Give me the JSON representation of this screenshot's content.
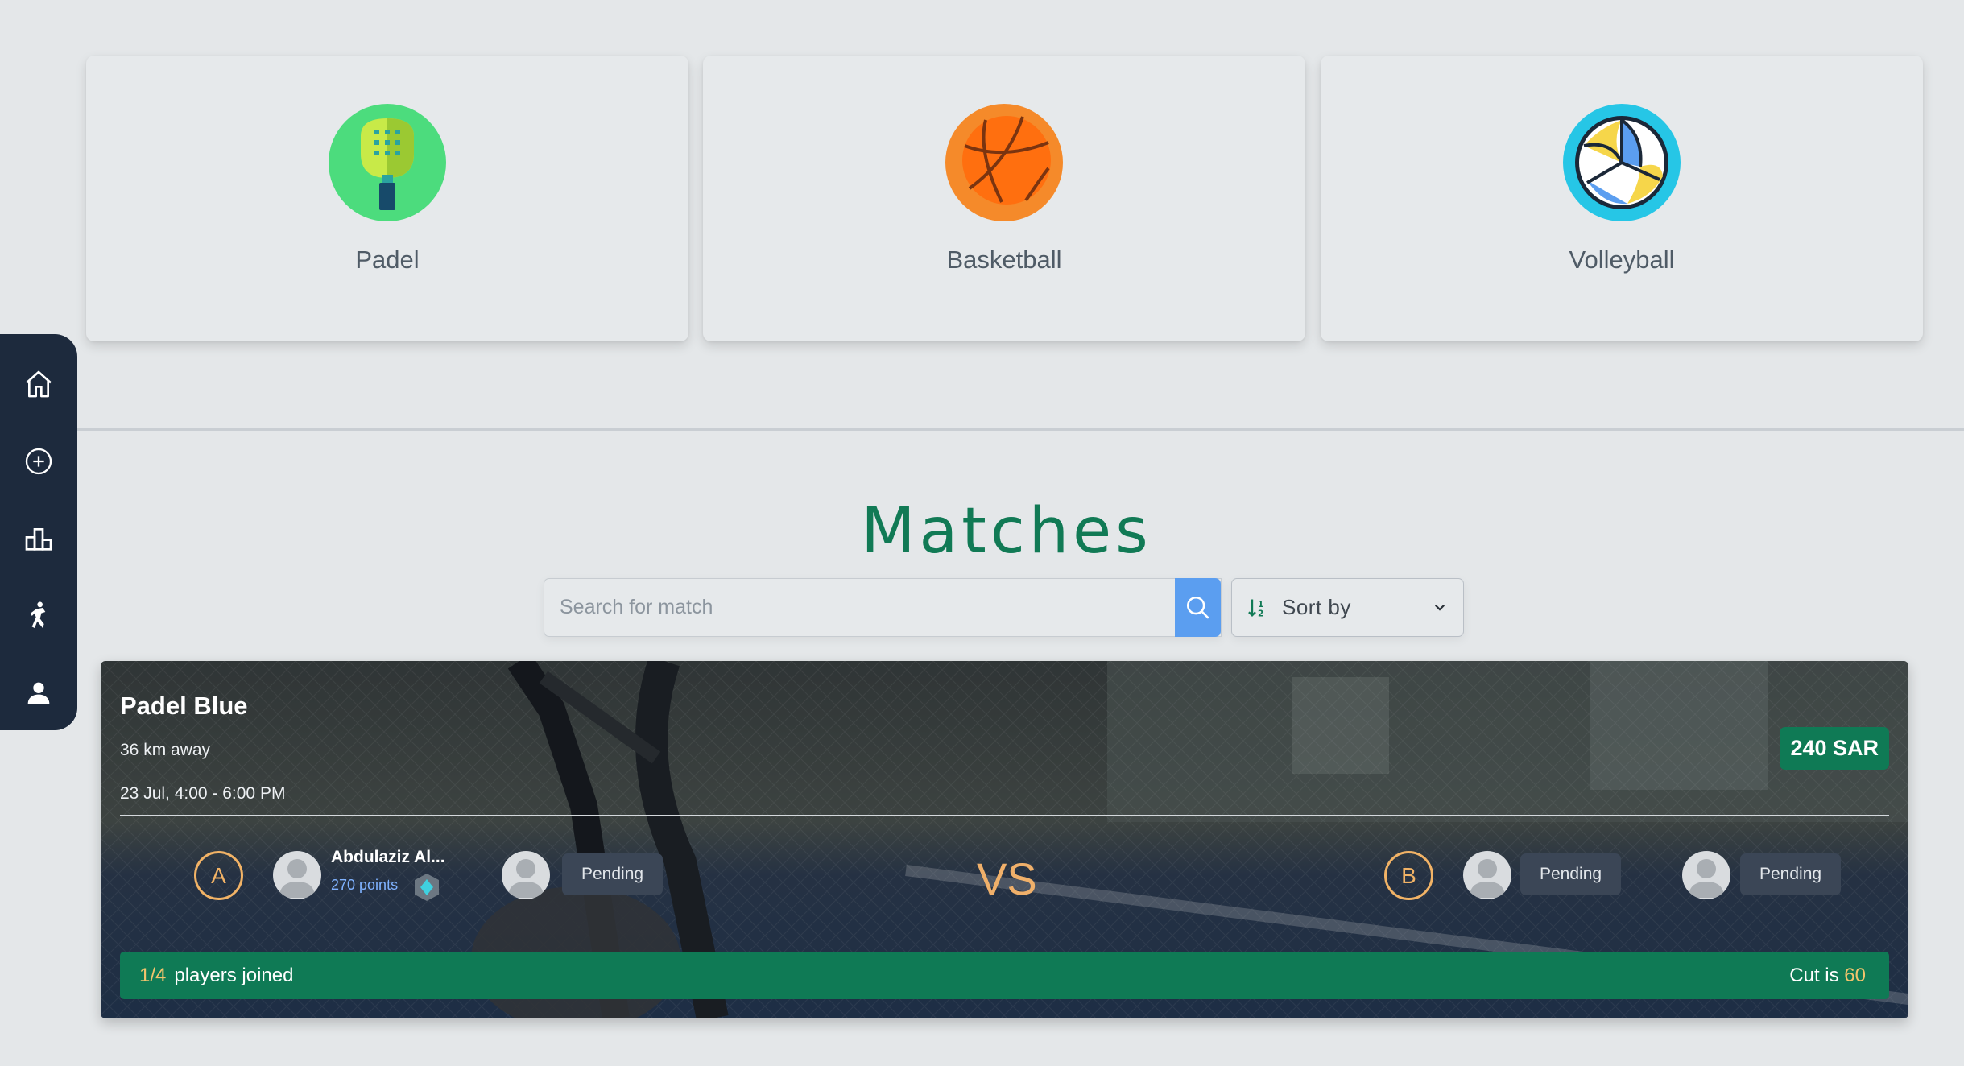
{
  "sidebar": {
    "items": [
      {
        "icon": "home-icon"
      },
      {
        "icon": "plus-circle-icon"
      },
      {
        "icon": "leaderboard-icon"
      },
      {
        "icon": "player-icon"
      },
      {
        "icon": "profile-icon"
      }
    ]
  },
  "sports": [
    {
      "label": "Padel",
      "icon": "padel-racket-icon"
    },
    {
      "label": "Basketball",
      "icon": "basketball-icon"
    },
    {
      "label": "Volleyball",
      "icon": "volleyball-icon"
    }
  ],
  "matches": {
    "title": "Matches",
    "search_placeholder": "Search for match",
    "sort_label": "Sort by"
  },
  "match_card": {
    "title": "Padel Blue",
    "distance": "36 km away",
    "time": "23 Jul, 4:00 - 6:00 PM",
    "price": "240 SAR",
    "team_a_label": "A",
    "team_b_label": "B",
    "vs_label": "VS",
    "player1_name": "Abdulaziz Al...",
    "player1_points": "270 points",
    "pending_label": "Pending",
    "joined_count": "1/4",
    "joined_label": "players joined",
    "cut_label": "Cut is",
    "cut_value": "60"
  },
  "colors": {
    "brand_green": "#117a55",
    "sidebar_bg": "#1d2a3d",
    "accent_orange": "#f2b366",
    "search_button": "#5b9ef0"
  }
}
